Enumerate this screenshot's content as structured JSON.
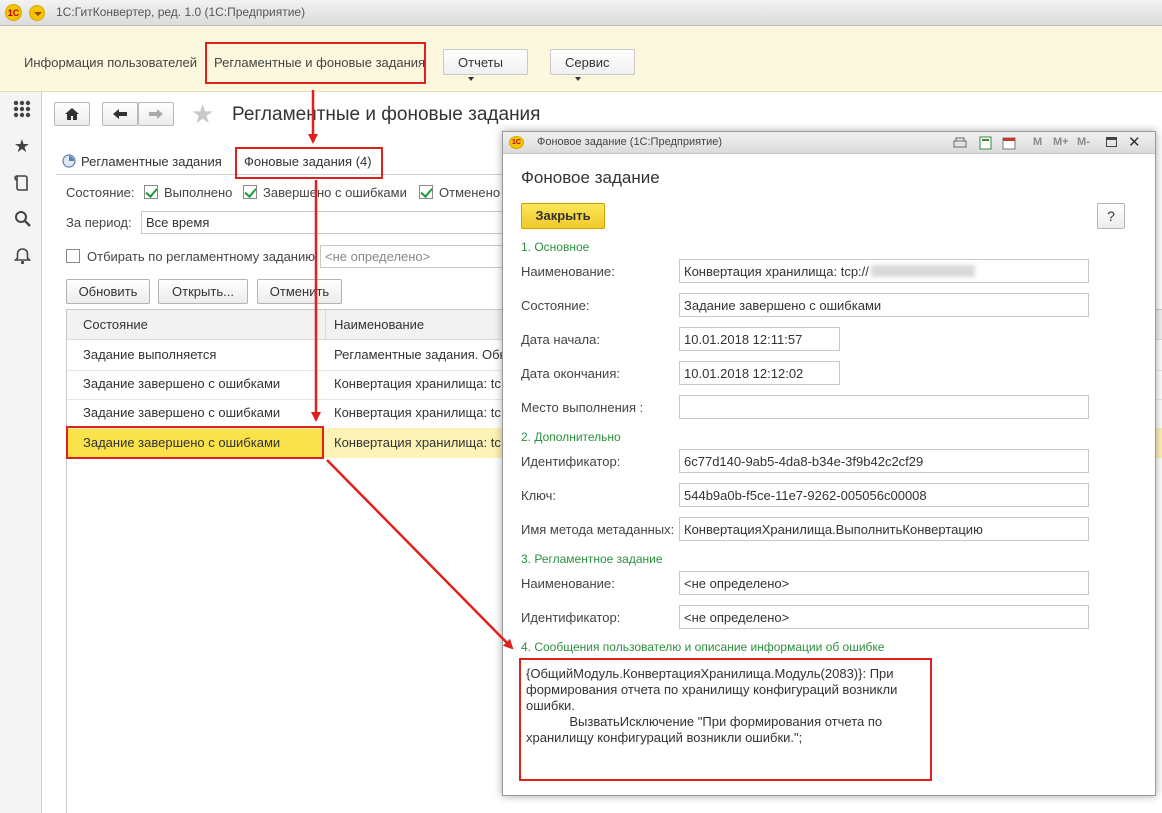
{
  "app": {
    "logo": "1С",
    "title": "1С:ГитКонвертер, ред. 1.0  (1С:Предприятие)"
  },
  "sections_panel": {
    "items": [
      {
        "label": "Информация пользователей"
      },
      {
        "label": "Регламентные и фоновые задания"
      }
    ],
    "reports_label": "Отчеты",
    "service_label": "Сервис"
  },
  "left_toolbar": {
    "icons": [
      "apps-grid-icon",
      "star-icon",
      "history-icon",
      "search-icon",
      "bell-icon"
    ]
  },
  "form": {
    "title": "Регламентные и фоновые задания",
    "tabs": [
      {
        "label": "Регламентные задания",
        "icon": "clock-icon"
      },
      {
        "label": "Фоновые задания (4)"
      }
    ],
    "state_label": "Состояние:",
    "filters": [
      {
        "label": "Выполнено",
        "checked": true
      },
      {
        "label": "Завершено с ошибками",
        "checked": true
      },
      {
        "label": "Отменено",
        "checked": true
      }
    ],
    "period_label": "За период:",
    "period_value": "Все время",
    "scheduled_filter_label": "Отбирать по регламентному заданию",
    "scheduled_filter_checked": false,
    "scheduled_filter_value": "<не определено>",
    "buttons": {
      "refresh": "Обновить",
      "open": "Открыть...",
      "cancel": "Отменить"
    },
    "grid": {
      "columns": [
        "Состояние",
        "Наименование"
      ],
      "rows": [
        {
          "state": "Задание выполняется",
          "name": "Регламентные задания. Обн"
        },
        {
          "state": "Задание завершено с ошибками",
          "name": "Конвертация хранилища: tc"
        },
        {
          "state": "Задание завершено с ошибками",
          "name": "Конвертация хранилища: tc"
        },
        {
          "state": "Задание завершено с ошибками",
          "name": "Конвертация хранилища: tc",
          "selected": true
        }
      ]
    }
  },
  "dialog": {
    "window_title": "Фоновое задание  (1С:Предприятие)",
    "window_buttons": [
      "M",
      "M+",
      "M-"
    ],
    "heading": "Фоновое задание",
    "close_label": "Закрыть",
    "help_label": "?",
    "section1": "1. Основное",
    "name_label": "Наименование:",
    "name_value": "Конвертация хранилища: tcp://",
    "state_label": "Состояние:",
    "state_value": "Задание завершено с ошибками",
    "start_label": "Дата начала:",
    "start_value": "10.01.2018 12:11:57",
    "end_label": "Дата окончания:",
    "end_value": "10.01.2018 12:12:02",
    "location_label": "Место выполнения :",
    "location_value": "",
    "section2": "2. Дополнительно",
    "id_label": "Идентификатор:",
    "id_value": "6c77d140-9ab5-4da8-b34e-3f9b42c2cf29",
    "key_label": "Ключ:",
    "key_value": "544b9a0b-f5ce-11e7-9262-005056c00008",
    "method_label": "Имя метода метаданных:",
    "method_value": "КонвертацияХранилища.ВыполнитьКонвертацию",
    "section3": "3. Регламентное задание",
    "sched_name_label": "Наименование:",
    "sched_name_value": "<не определено>",
    "sched_id_label": "Идентификатор:",
    "sched_id_value": "<не определено>",
    "section4": "4. Сообщения пользователю и описание информации об ошибке",
    "message_lines": [
      "{ОбщийМодуль.КонвертацияХранилища.Модуль(2083)}: При",
      "формирования отчета по хранилищу конфигураций возникли",
      "ошибки.",
      "            ВызватьИсключение \"При формирования отчета по",
      "хранилищу конфигураций возникли ошибки.\";"
    ]
  },
  "colors": {
    "accent_yellow": "#f5c400",
    "panel_bg": "#fbf8dd",
    "highlight_red": "#e0201c",
    "section_green": "#2c8f3e",
    "selected_row": "#f9e24a",
    "checkbox_green": "#1c9a3a"
  }
}
